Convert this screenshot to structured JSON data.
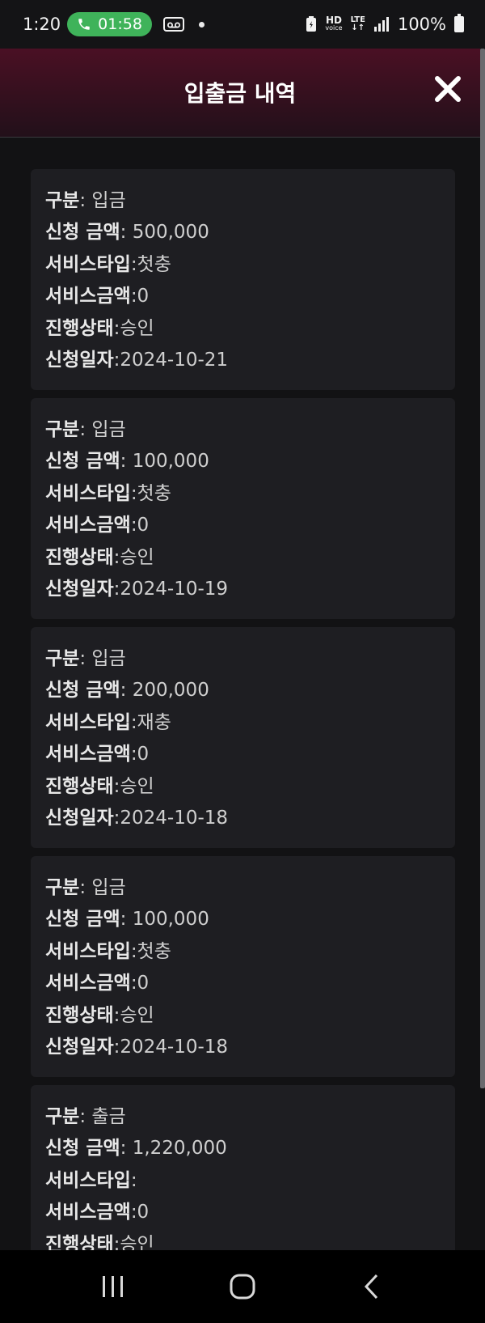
{
  "status": {
    "time": "1:20",
    "call_timer": "01:58",
    "hd_label": "HD",
    "voice_label": "voice",
    "lte_label": "LTE",
    "battery": "100%"
  },
  "header": {
    "title": "입출금 내역"
  },
  "labels": {
    "type": "구분",
    "amount": "신청 금액",
    "service_type": "서비스타입",
    "service_amount": "서비스금액",
    "status": "진행상태",
    "date": "신청일자"
  },
  "records": [
    {
      "type": ": 입금",
      "amount": ": 500,000",
      "service_type": ":첫충",
      "service_amount": ":0",
      "status": ":승인",
      "date": ":2024-10-21"
    },
    {
      "type": ": 입금",
      "amount": ": 100,000",
      "service_type": ":첫충",
      "service_amount": ":0",
      "status": ":승인",
      "date": ":2024-10-19"
    },
    {
      "type": ": 입금",
      "amount": ": 200,000",
      "service_type": ":재충",
      "service_amount": ":0",
      "status": ":승인",
      "date": ":2024-10-18"
    },
    {
      "type": ": 입금",
      "amount": ": 100,000",
      "service_type": ":첫충",
      "service_amount": ":0",
      "status": ":승인",
      "date": ":2024-10-18"
    },
    {
      "type": ": 출금",
      "amount": ": 1,220,000",
      "service_type": ":",
      "service_amount": ":0",
      "status": ":승인"
    }
  ]
}
